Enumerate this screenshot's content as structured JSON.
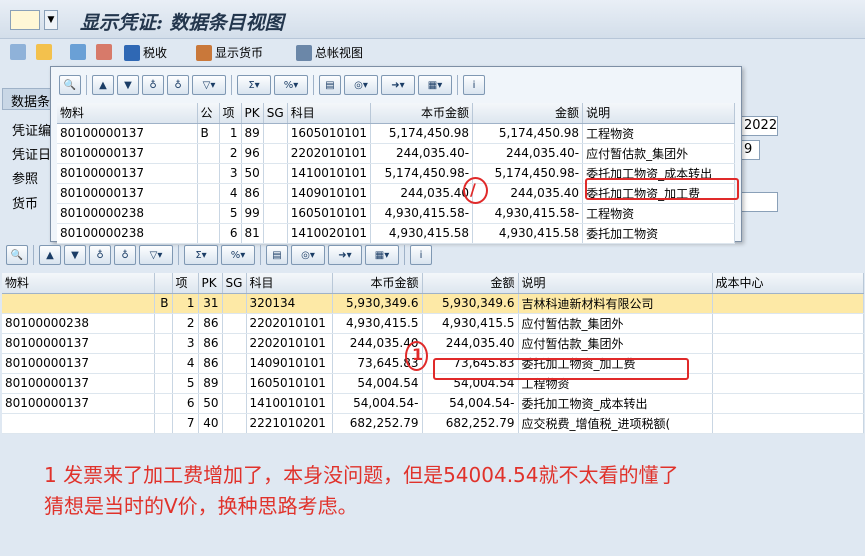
{
  "window": {
    "title": "显示凭证: 数据条目视图"
  },
  "toolbar": {
    "tax_label": "税收",
    "display_currency_label": "显示货币",
    "ledger_view_label": "总帐视图"
  },
  "data_section": {
    "header": "数据条",
    "fields": [
      {
        "label": "凭证编",
        "value": ""
      },
      {
        "label": "凭证日",
        "value": ""
      },
      {
        "label": "参照",
        "value": ""
      },
      {
        "label": "货币",
        "value": ""
      }
    ],
    "year_value": "2022",
    "extra_value": "9"
  },
  "popup_table": {
    "columns": [
      "物料",
      "公",
      "项",
      "PK",
      "SG",
      "科目",
      "本币金额",
      "金额",
      "说明"
    ],
    "rows": [
      [
        "80100000137",
        "B",
        "1",
        "89",
        "",
        "1605010101",
        "5,174,450.98",
        "5,174,450.98",
        "工程物资"
      ],
      [
        "80100000137",
        "",
        "2",
        "96",
        "",
        "2202010101",
        "244,035.40-",
        "244,035.40-",
        "应付暂估款_集团外"
      ],
      [
        "80100000137",
        "",
        "3",
        "50",
        "",
        "1410010101",
        "5,174,450.98-",
        "5,174,450.98-",
        "委托加工物资_成本转出"
      ],
      [
        "80100000137",
        "",
        "4",
        "86",
        "",
        "1409010101",
        "244,035.40",
        "244,035.40",
        "委托加工物资_加工费"
      ],
      [
        "80100000238",
        "",
        "5",
        "99",
        "",
        "1605010101",
        "4,930,415.58-",
        "4,930,415.58-",
        "工程物资"
      ],
      [
        "80100000238",
        "",
        "6",
        "81",
        "",
        "1410020101",
        "4,930,415.58",
        "4,930,415.58",
        "委托加工物资"
      ]
    ]
  },
  "main_table": {
    "columns": [
      "物料",
      "",
      "项",
      "PK",
      "SG",
      "科目",
      "本币金额",
      "金额",
      "说明",
      "成本中心"
    ],
    "rows": [
      [
        "",
        "B",
        "1",
        "31",
        "",
        "320134",
        "5,930,349.6",
        "5,930,349.6",
        "吉林科迪新材料有限公司",
        ""
      ],
      [
        "80100000238",
        "",
        "2",
        "86",
        "",
        "2202010101",
        "4,930,415.5",
        "4,930,415.5",
        "应付暂估款_集团外",
        ""
      ],
      [
        "80100000137",
        "",
        "3",
        "86",
        "",
        "2202010101",
        "244,035.40",
        "244,035.40",
        "应付暂估款_集团外",
        ""
      ],
      [
        "80100000137",
        "",
        "4",
        "86",
        "",
        "1409010101",
        "73,645.83",
        "73,645.83",
        "委托加工物资_加工费",
        ""
      ],
      [
        "80100000137",
        "",
        "5",
        "89",
        "",
        "1605010101",
        "54,004.54",
        "54,004.54",
        "工程物资",
        ""
      ],
      [
        "80100000137",
        "",
        "6",
        "50",
        "",
        "1410010101",
        "54,004.54-",
        "54,004.54-",
        "委托加工物资_成本转出",
        ""
      ],
      [
        "",
        "",
        "7",
        "40",
        "",
        "2221010201",
        "682,252.79",
        "682,252.79",
        "应交税费_增值税_进项税额(",
        ""
      ]
    ]
  },
  "annotation": {
    "marker_popup": "/",
    "marker_main": "1",
    "line1": "1 发票来了加工费增加了，本身没问题，但是54004.54就不太看的懂了",
    "line2": "猜想是当时的V价，换种思路考虑。"
  }
}
